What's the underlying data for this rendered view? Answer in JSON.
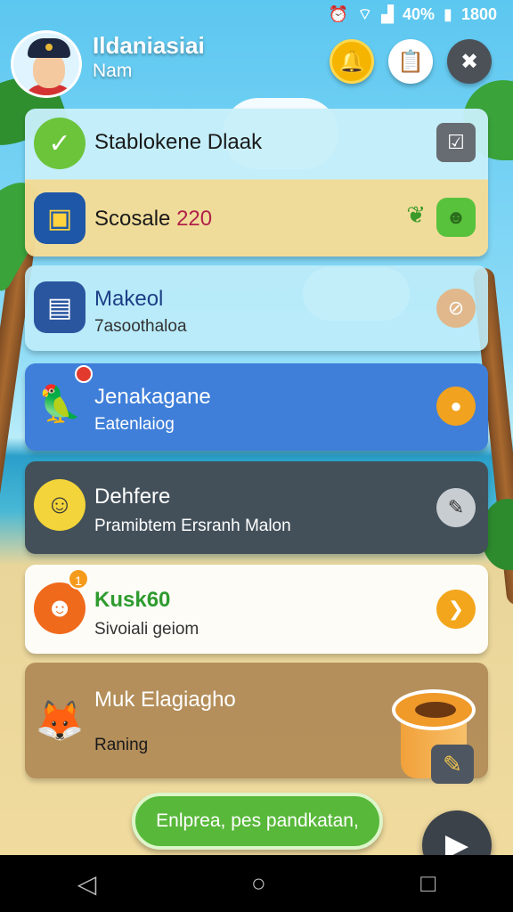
{
  "status_bar": {
    "battery": "40%",
    "time": "1800"
  },
  "profile": {
    "name": "Ildaniasiai",
    "subtitle": "Nam"
  },
  "header_buttons": [
    {
      "icon": "bell-icon"
    },
    {
      "icon": "clipboard-icon"
    },
    {
      "icon": "menu-grid-icon"
    }
  ],
  "cards": [
    {
      "title": "Stablokene Dlaak",
      "icon": "checkmark-icon",
      "action_icon": "check-square-icon"
    },
    {
      "title_prefix": "Scosale ",
      "title_number": "220",
      "icon": "phone-card-icon",
      "action_icon": "green-robot-icon"
    },
    {
      "title": "Makeol",
      "subtitle": "7asoothaloa",
      "icon": "book-icon",
      "action_icon": "slash-icon"
    },
    {
      "title": "Jenakagane",
      "subtitle": "Eatenlaiog",
      "icon": "parrot-icon",
      "action_icon": "fruit-icon"
    },
    {
      "title": "Dehfere",
      "subtitle": "Pramibtem Ersranh Malon",
      "icon": "cat-icon",
      "action_icon": "feather-icon"
    },
    {
      "title": "Kusk60",
      "subtitle": "Sivoiali geiom",
      "badge": "1",
      "icon": "orange-creature-icon",
      "action_icon": "arrow-icon"
    },
    {
      "title": "Muk Elagiagho",
      "subtitle": "Raning",
      "icon": "fox-icon"
    }
  ],
  "cta": {
    "label": "Enlprea, pes pandkatan,"
  },
  "fab": {
    "icon": "play-arrow-icon"
  },
  "navbar": [
    "back-icon",
    "home-icon",
    "recents-icon"
  ]
}
